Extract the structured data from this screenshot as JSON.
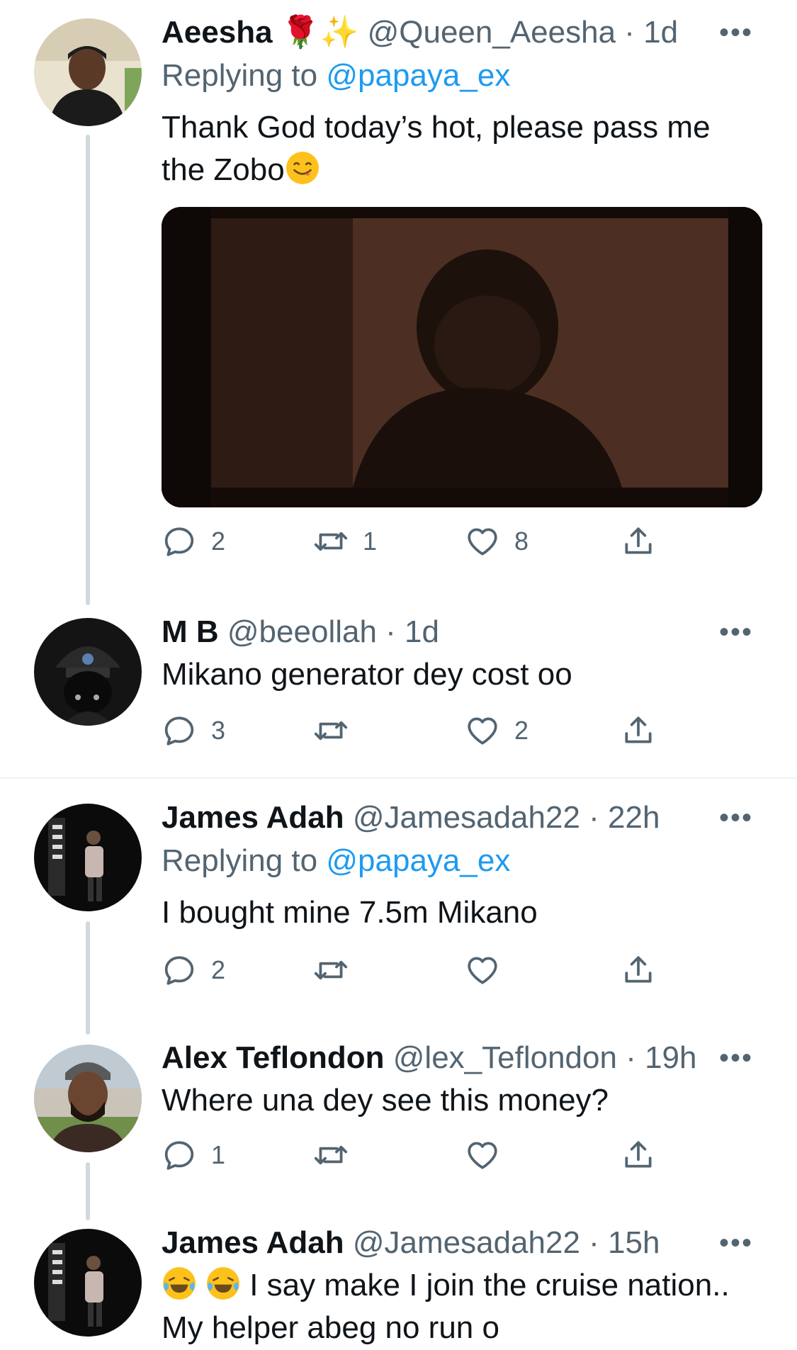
{
  "tweets": [
    {
      "name": "Aeesha",
      "name_emoji": "🌹✨",
      "handle": "@Queen_Aeesha",
      "time": "1d",
      "replying_prefix": "Replying to ",
      "replying_to": "@papaya_ex",
      "text_line1": "Thank God today’s hot, please pass me",
      "text_line2": "the Zobo",
      "replies": "2",
      "retweets": "1",
      "likes": "8"
    },
    {
      "name": "M B",
      "handle": "@beeollah",
      "time": "1d",
      "text": "Mikano generator dey cost oo",
      "replies": "3",
      "retweets": "",
      "likes": "2"
    },
    {
      "name": "James Adah",
      "handle": "@Jamesadah22",
      "time": "22h",
      "replying_prefix": "Replying to ",
      "replying_to": "@papaya_ex",
      "text": "I bought mine 7.5m Mikano",
      "replies": "2",
      "retweets": "",
      "likes": ""
    },
    {
      "name": "Alex Teflondon",
      "handle": "@lex_Teflondon",
      "time": "19h",
      "text": "Where una dey see this money?",
      "replies": "1",
      "retweets": "",
      "likes": ""
    },
    {
      "name": "James Adah",
      "handle": "@Jamesadah22",
      "time": "15h",
      "text_line1": " I say make I join the cruise nation..",
      "text_line2": "My helper abeg no run o"
    }
  ],
  "separator": " · ",
  "more_glyph": "•••",
  "icons": {
    "reply": "reply-icon",
    "retweet": "retweet-icon",
    "like": "heart-icon",
    "share": "share-icon",
    "more": "more-icon"
  },
  "colors": {
    "accent": "#1d9bf0",
    "muted": "#536471",
    "thread_line": "#cfd9de"
  }
}
